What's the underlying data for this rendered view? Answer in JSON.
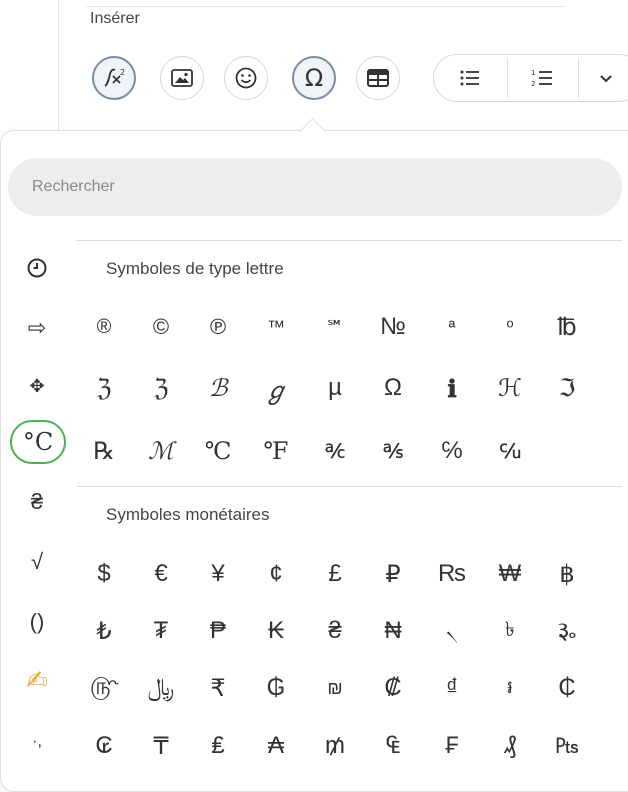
{
  "header": {
    "insert_label": "Insérer"
  },
  "search": {
    "placeholder": "Rechercher"
  },
  "categories": [
    "🕘",
    "⇨",
    "✥",
    "°C",
    "₴",
    "√",
    "()",
    "✍",
    "·,"
  ],
  "sections": [
    {
      "title": "Symboles de type lettre",
      "rows": [
        [
          "®",
          "©",
          "℗",
          "™",
          "℠",
          "№",
          "ª",
          "º",
          "℔"
        ],
        [
          "ℨ",
          "ℨ",
          "ℬ",
          "ℊ",
          "µ",
          "Ω",
          "ℹ",
          "ℋ",
          "ℑ"
        ],
        [
          "℞",
          "ℳ",
          "℃",
          "℉",
          "℀",
          "℁",
          "℅",
          "℆"
        ]
      ]
    },
    {
      "title": "Symboles monétaires",
      "rows": [
        [
          "$",
          "€",
          "¥",
          "¢",
          "£",
          "₽",
          "₨",
          "₩",
          "฿"
        ],
        [
          "₺",
          "₮",
          "₱",
          "₭",
          "₴",
          "₦",
          "৲",
          "৳",
          "૱"
        ],
        [
          "௹",
          "﷼",
          "₹",
          "₲",
          "₪",
          "₡",
          "₫",
          "៛",
          "₵"
        ],
        [
          "₢",
          "₸",
          "₤",
          "₳",
          "₥",
          "₠",
          "₣",
          "₰",
          "₧"
        ]
      ]
    }
  ],
  "colors": {
    "active_category_border": "#4caf50",
    "active_toolbar_border": "#7b8aa3"
  }
}
